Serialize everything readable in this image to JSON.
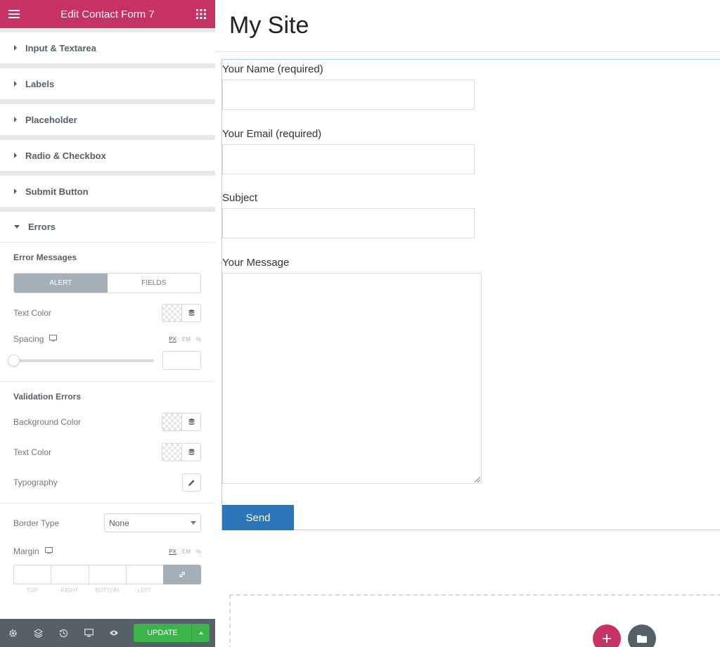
{
  "panel": {
    "title": "Edit Contact Form 7",
    "sections": [
      {
        "label": "Input & Textarea"
      },
      {
        "label": "Labels"
      },
      {
        "label": "Placeholder"
      },
      {
        "label": "Radio & Checkbox"
      },
      {
        "label": "Submit Button"
      },
      {
        "label": "Errors"
      }
    ],
    "errors": {
      "error_messages_title": "Error Messages",
      "toggle": {
        "alert": "ALERT",
        "fields": "FIELDS",
        "active": "ALERT"
      },
      "text_color_label": "Text Color",
      "spacing_label": "Spacing",
      "units": [
        "PX",
        "EM",
        "%"
      ],
      "validation_title": "Validation Errors",
      "bg_color_label": "Background Color",
      "text_color_label_2": "Text Color",
      "typography_label": "Typography",
      "border_type_label": "Border Type",
      "border_type_value": "None",
      "margin_label": "Margin",
      "dim_labels": [
        "TOP",
        "RIGHT",
        "BOTTOM",
        "LEFT"
      ]
    },
    "footer": {
      "update_label": "UPDATE",
      "icons": [
        "gear-icon",
        "layers-icon",
        "history-icon",
        "responsive-icon",
        "eye-icon"
      ]
    }
  },
  "preview": {
    "site_title": "My Site",
    "form": {
      "name_label": "Your Name (required)",
      "email_label": "Your Email (required)",
      "subject_label": "Subject",
      "message_label": "Your Message",
      "send_label": "Send"
    }
  },
  "colors": {
    "brand": "#c73262",
    "panel_bg": "#e6e9ec",
    "footer_bg": "#556068",
    "update_green": "#39b54a",
    "send_blue": "#2c75b9",
    "form_outline": "#a9d2e9"
  }
}
